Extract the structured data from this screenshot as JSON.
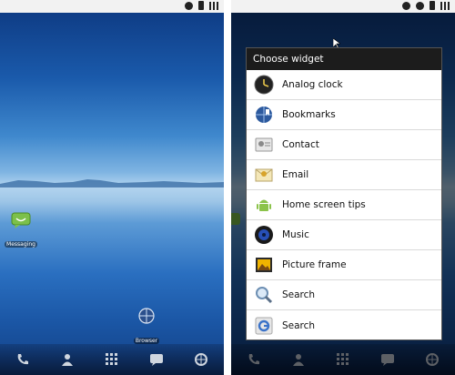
{
  "left_screen": {
    "apps": [
      {
        "label": "Messaging",
        "icon": "messaging-icon"
      },
      {
        "label": "Browser",
        "icon": "browser-icon"
      }
    ],
    "dock": [
      "phone-icon",
      "contacts-icon",
      "apps-grid-icon",
      "messaging-icon",
      "browser-icon"
    ]
  },
  "right_screen": {
    "partial_app_label": "Me",
    "dialog": {
      "title": "Choose widget",
      "items": [
        {
          "label": "Analog clock",
          "icon": "analog-clock-icon"
        },
        {
          "label": "Bookmarks",
          "icon": "bookmarks-icon"
        },
        {
          "label": "Contact",
          "icon": "contact-icon"
        },
        {
          "label": "Email",
          "icon": "email-icon"
        },
        {
          "label": "Home screen tips",
          "icon": "android-icon"
        },
        {
          "label": "Music",
          "icon": "music-icon"
        },
        {
          "label": "Picture frame",
          "icon": "picture-frame-icon"
        },
        {
          "label": "Search",
          "icon": "search-magnifier-icon"
        },
        {
          "label": "Search",
          "icon": "google-search-icon"
        }
      ]
    }
  }
}
